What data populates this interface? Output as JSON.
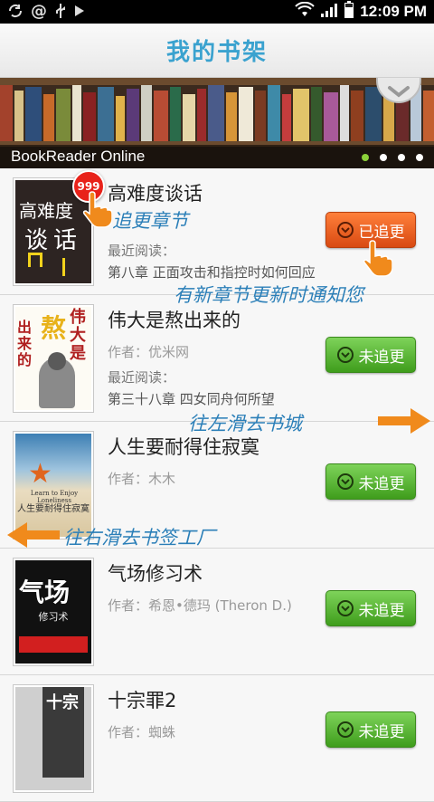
{
  "status_bar": {
    "time": "12:09 PM",
    "icons": [
      "sync-icon",
      "at-icon",
      "usb-icon",
      "play-icon",
      "wifi-icon",
      "signal-icon",
      "battery-icon"
    ]
  },
  "header": {
    "title": "我的书架"
  },
  "banner": {
    "caption": "BookReader Online",
    "page_count": 4,
    "active_page": 0
  },
  "books": [
    {
      "title": "高难度谈话",
      "author": "",
      "recent_label": "最近阅读：",
      "recent_chapter": "第八章 正面攻击和指控时如何回应",
      "button": "已追更",
      "button_state": "following",
      "badge": "999"
    },
    {
      "title": "伟大是熬出来的",
      "author": "作者：优米网",
      "recent_label": "最近阅读：",
      "recent_chapter": "第三十八章 四女同舟何所望",
      "button": "未追更",
      "button_state": "not-following"
    },
    {
      "title": "人生要耐得住寂寞",
      "author": "作者：木木",
      "recent_label": "",
      "recent_chapter": "",
      "button": "未追更",
      "button_state": "not-following"
    },
    {
      "title": "气场修习术",
      "author": "作者：希恩•德玛 (Theron D.)",
      "recent_label": "",
      "recent_chapter": "",
      "button": "未追更",
      "button_state": "not-following"
    },
    {
      "title": "十宗罪2",
      "author": "作者：蜘蛛",
      "recent_label": "",
      "recent_chapter": "",
      "button": "未追更",
      "button_state": "not-following"
    }
  ],
  "covers": {
    "book1": {
      "line1": "高难度",
      "line2": "谈话"
    },
    "book2": {
      "line1": "伟大是",
      "line2": "熬",
      "line3": "出来的"
    },
    "book3": {
      "title_en": "Learn to Enjoy Loneliness",
      "title_cn": "人生要耐得住寂寞"
    },
    "book4": {
      "title": "气场",
      "subtitle": "修习术"
    },
    "book5": {
      "title": "十宗"
    }
  },
  "annotations": {
    "chase_chapter": "追更章节",
    "notify_update": "有新章节更新时通知您",
    "swipe_left": "往左滑去书城",
    "swipe_right": "往右滑去书签工厂"
  },
  "colors": {
    "title_blue": "#3aa2cf",
    "button_green": "#4fae28",
    "button_orange": "#e2581a",
    "annotation_blue": "#2b7fb8",
    "arrow_orange": "#f08a1c"
  }
}
